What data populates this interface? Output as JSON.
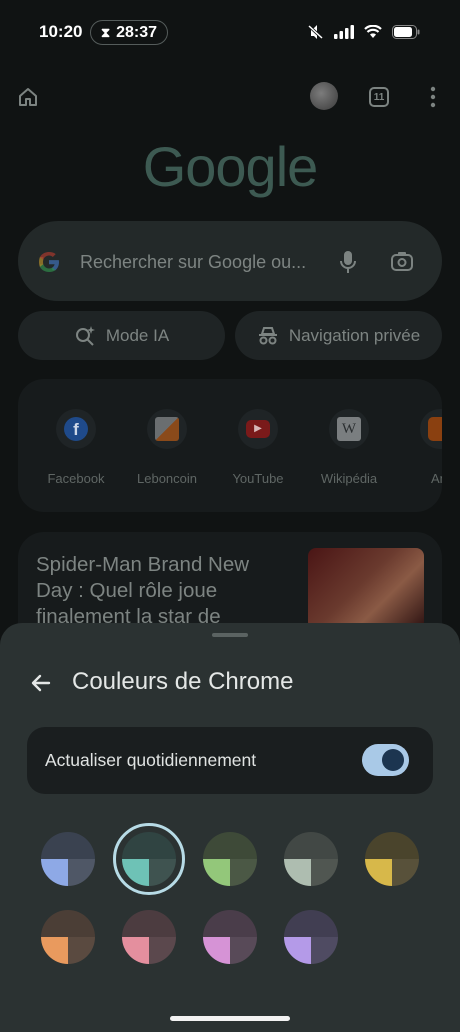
{
  "status_bar": {
    "time": "10:20",
    "timer": "28:37"
  },
  "toolbar": {
    "tab_count": "11"
  },
  "logo": "Google",
  "search": {
    "placeholder": "Rechercher sur Google ou..."
  },
  "pills": {
    "ai_mode": "Mode IA",
    "incognito": "Navigation privée"
  },
  "shortcuts": [
    {
      "label": "Facebook",
      "icon": "facebook-icon"
    },
    {
      "label": "Leboncoin",
      "icon": "leboncoin-icon"
    },
    {
      "label": "YouTube",
      "icon": "youtube-icon"
    },
    {
      "label": "Wikipédia",
      "icon": "wikipedia-icon"
    },
    {
      "label": "Ama",
      "icon": "amazon-icon"
    }
  ],
  "news": {
    "title": "Spider-Man Brand New Day : Quel rôle joue finalement la star de"
  },
  "sheet": {
    "title": "Couleurs de Chrome",
    "toggle_label": "Actualiser quotidiennement",
    "toggle_on": true,
    "selected_swatch": 1,
    "swatches": [
      {
        "top": "#3a4250",
        "bottom_left": "#8ea9e6",
        "bottom_right": "#4f5766"
      },
      {
        "top": "#304442",
        "bottom_left": "#6ec2b6",
        "bottom_right": "#3f5350"
      },
      {
        "top": "#3e4a38",
        "bottom_left": "#93c77a",
        "bottom_right": "#4b5845"
      },
      {
        "top": "#424845",
        "bottom_left": "#aebdb0",
        "bottom_right": "#505651"
      },
      {
        "top": "#4a442c",
        "bottom_left": "#d7b84a",
        "bottom_right": "#58513a"
      },
      {
        "top": "#4b3e36",
        "bottom_left": "#e99a5e",
        "bottom_right": "#5a4a40"
      },
      {
        "top": "#4c3c40",
        "bottom_left": "#e48f9e",
        "bottom_right": "#5b484d"
      },
      {
        "top": "#4a3d4a",
        "bottom_left": "#d693d6",
        "bottom_right": "#584a58"
      },
      {
        "top": "#413e52",
        "bottom_left": "#b49ae8",
        "bottom_right": "#4f4b62"
      }
    ]
  }
}
